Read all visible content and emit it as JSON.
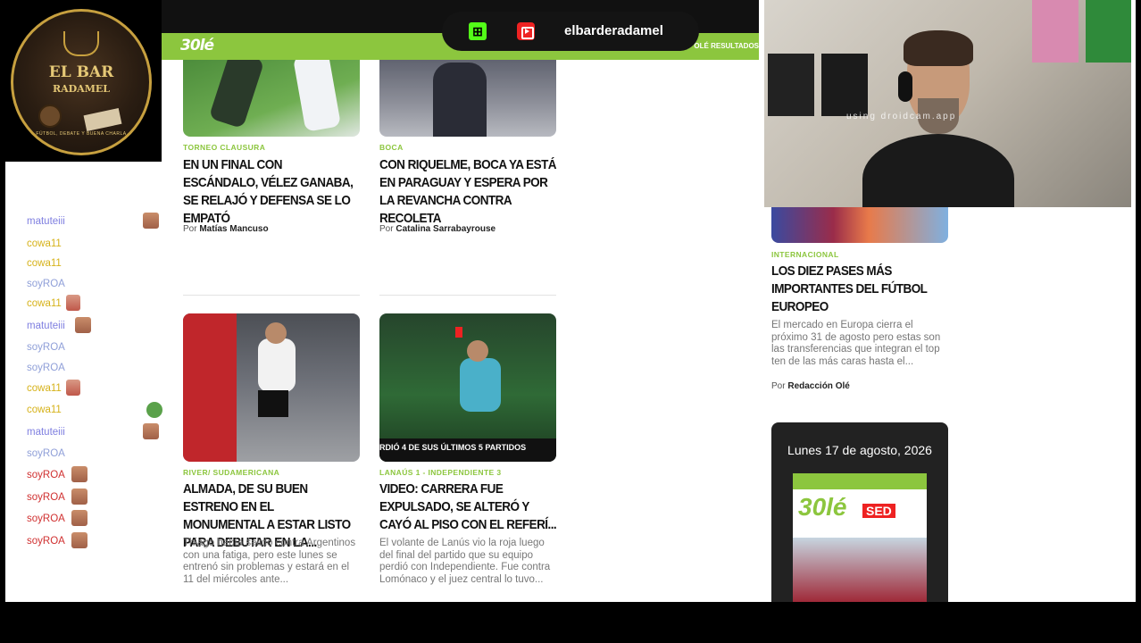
{
  "stream": {
    "kick_glyph": "⊞",
    "channel_name": "elbarderadamel"
  },
  "logo": {
    "title": "EL BAR",
    "subtitle": "RADAMEL",
    "tagline": "FÚTBOL, DEBATE Y BUENA CHARLA"
  },
  "navbar": {
    "logo_text": "30lé",
    "results_label": "OLÉ RESULTADOS"
  },
  "chat": {
    "messages": [
      {
        "user": "matuteiii",
        "color": "#7f7fe0",
        "emote": "face"
      },
      {
        "user": "cowa11",
        "color": "#d6b21a",
        "emote": null
      },
      {
        "user": "cowa11",
        "color": "#d6b21a",
        "emote": null
      },
      {
        "user": "soyROA",
        "color": "#8f9fd8",
        "emote": null
      },
      {
        "user": "cowa11",
        "color": "#d6b21a",
        "emote": "hand"
      },
      {
        "user": "matuteiii",
        "color": "#7f7fe0",
        "emote": "face"
      },
      {
        "user": "soyROA",
        "color": "#8f9fd8",
        "emote": null
      },
      {
        "user": "soyROA",
        "color": "#8f9fd8",
        "emote": null
      },
      {
        "user": "cowa11",
        "color": "#d6b21a",
        "emote": "hand"
      },
      {
        "user": "cowa11",
        "color": "#d6b21a",
        "emote": "frog"
      },
      {
        "user": "matuteiii",
        "color": "#7f7fe0",
        "emote": "face"
      },
      {
        "user": "soyROA",
        "color": "#8f9fd8",
        "emote": null
      },
      {
        "user": "soyROA",
        "color": "#d03030",
        "emote": "face"
      },
      {
        "user": "soyROA",
        "color": "#d03030",
        "emote": "face"
      },
      {
        "user": "soyROA",
        "color": "#d03030",
        "emote": "face"
      },
      {
        "user": "soyROA",
        "color": "#d03030",
        "emote": "face"
      }
    ]
  },
  "articles": {
    "a1": {
      "category": "TORNEO CLAUSURA",
      "title": "EN UN FINAL CON ESCÁNDALO, VÉLEZ GANABA, SE RELAJÓ Y DEFENSA SE LO EMPATÓ",
      "byline_prefix": "Por",
      "author": "Matías Mancuso"
    },
    "a2": {
      "category": "BOCA",
      "title": "CON RIQUELME, BOCA YA ESTÁ EN PARAGUAY Y ESPERA POR LA REVANCHA CONTRA RECOLETA",
      "byline_prefix": "Por",
      "author": "Catalina Sarrabayrouse"
    },
    "a3": {
      "category": "RIVER/ SUDAMERICANA",
      "title": "ALMADA, DE SU BUEN ESTRENO EN EL MONUMENTAL A ESTAR LISTO PARA DEBUTAR EN LA...",
      "excerpt": "Thiago había salido contra Argentinos con una fatiga, pero este lunes se entrenó sin problemas y estará en el 11 del miércoles ante..."
    },
    "a4": {
      "category": "LANAÚS 1 - INDEPENDIENTE 3",
      "title": "VIDEO: CARRERA FUE EXPULSADO, SE ALTERÓ Y CAYÓ AL PISO CON EL REFERÍ...",
      "excerpt": "El volante de Lanús vio la roja luego del final del partido que su equipo perdió con Independiente. Fue contra Lomónaco y el juez central lo tuvo...",
      "thumb_caption": "RDIÓ 4 DE SUS ÚLTIMOS 5 PARTIDOS"
    },
    "side": {
      "category": "INTERNACIONAL",
      "title": "LOS DIEZ PASES MÁS IMPORTANTES DEL FÚTBOL EUROPEO",
      "excerpt": "El mercado en Europa cierra el próximo 31 de agosto pero estas son las transferencias que integran el top ten de las más caras hasta el...",
      "byline_prefix": "Por",
      "author": "Redacción Olé"
    }
  },
  "cover": {
    "date": "Lunes 17 de agosto, 2026",
    "logo": "30lé",
    "headline_tag": "SED"
  },
  "webcam": {
    "watermark": "using droidcam.app"
  }
}
